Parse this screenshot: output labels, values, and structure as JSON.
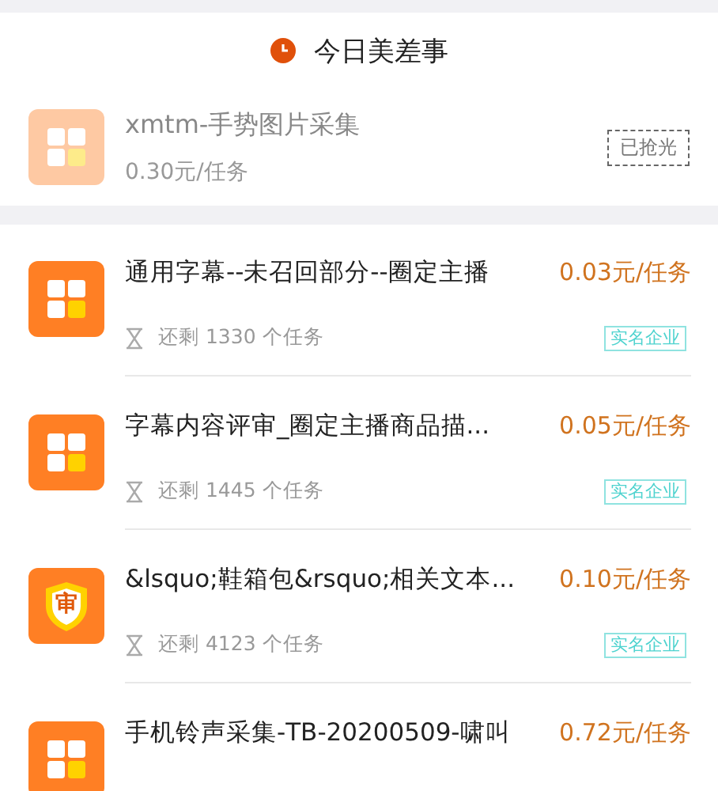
{
  "header": {
    "title": "今日美差事"
  },
  "featured": {
    "title": "xmtm-手势图片采集",
    "price": "0.30元/任务",
    "badge": "已抢光",
    "kind": "grid",
    "sold_out": true
  },
  "tasks": [
    {
      "title": "通用字幕--未召回部分--圈定主播",
      "price": "0.03元/任务",
      "remaining": "还剩 1330 个任务",
      "badge": "实名企业",
      "kind": "grid"
    },
    {
      "title": "字幕内容评审_圈定主播商品描...",
      "price": "0.05元/任务",
      "remaining": "还剩 1445 个任务",
      "badge": "实名企业",
      "kind": "grid"
    },
    {
      "title": "&lsquo;鞋箱包&rsquo;相关文本...",
      "price": "0.10元/任务",
      "remaining": "还剩 4123 个任务",
      "badge": "实名企业",
      "kind": "shield",
      "icon_text": "审"
    },
    {
      "title": "手机铃声采集-TB-20200509-啸叫",
      "price": "0.72元/任务",
      "kind": "grid"
    }
  ]
}
